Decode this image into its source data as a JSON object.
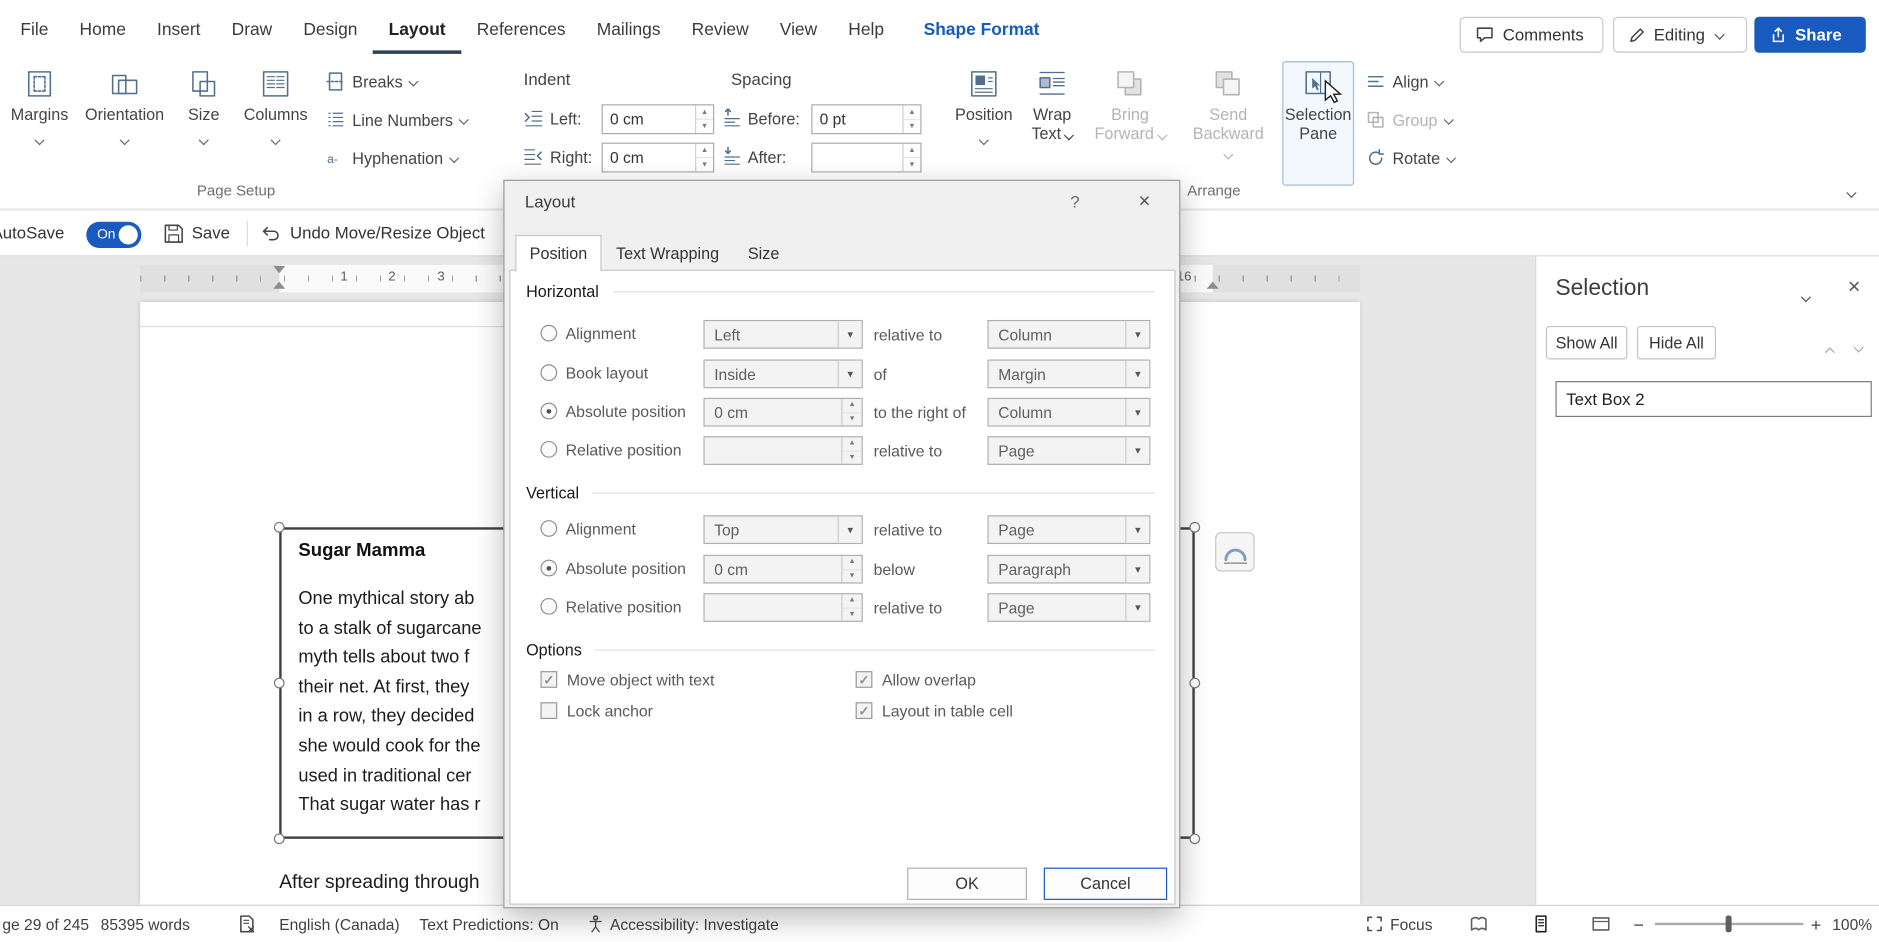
{
  "colors": {
    "accent": "#185abd",
    "underline": "#2d4257",
    "disabled": "#b4b4b4"
  },
  "ribbon": {
    "tabs": [
      "File",
      "Home",
      "Insert",
      "Draw",
      "Design",
      "Layout",
      "References",
      "Mailings",
      "Review",
      "View",
      "Help",
      "Shape Format"
    ],
    "actions": {
      "comments": "Comments",
      "editing": "Editing",
      "share": "Share"
    },
    "page_setup": {
      "group": "Page Setup",
      "margins": "Margins",
      "orientation": "Orientation",
      "size": "Size",
      "columns": "Columns",
      "breaks": "Breaks",
      "line_numbers": "Line Numbers",
      "hyphenation": "Hyphenation"
    },
    "paragraph": {
      "indent": "Indent",
      "spacing": "Spacing",
      "left": "Left:",
      "left_value": "0 cm",
      "right": "Right:",
      "right_value": "0 cm",
      "before": "Before:",
      "before_value": "0 pt",
      "after": "After:",
      "after_value": ""
    },
    "arrange": {
      "group": "Arrange",
      "position": "Position",
      "wrap_text": "Wrap Text",
      "bring_forward": "Bring Forward",
      "send_backward": "Send Backward",
      "selection_pane": "Selection Pane",
      "align": "Align",
      "group_btn": "Group",
      "rotate": "Rotate"
    }
  },
  "qat": {
    "autosave": "AutoSave",
    "autosave_state": "On",
    "save": "Save",
    "undo": "Undo Move/Resize Object"
  },
  "ruler": {
    "n1": "1",
    "n2": "2",
    "n3": "3",
    "n16": "16"
  },
  "document": {
    "textbox_title": "Sugar Mamma",
    "lines": [
      "One mythical story ab",
      "to a stalk of sugarcane",
      "myth tells about two f",
      "their net. At first, they",
      "in a row, they decided",
      "she would cook for the",
      "used in traditional cer",
      "That sugar water has r"
    ],
    "after_text": "After spreading through"
  },
  "dialog": {
    "title": "Layout",
    "help": "?",
    "close": "×",
    "tabs": {
      "position": "Position",
      "wrapping": "Text Wrapping",
      "size": "Size"
    },
    "horizontal": {
      "section": "Horizontal",
      "rows": [
        {
          "label": "Alignment",
          "dot": "",
          "value": "Left",
          "mid": "relative to",
          "value2": "Column"
        },
        {
          "label": "Book layout",
          "dot": "",
          "value": "Inside",
          "mid": "of",
          "value2": "Margin"
        },
        {
          "label": "Absolute position",
          "dot": "●",
          "value": "0 cm",
          "mid": "to the right of",
          "value2": "Column"
        },
        {
          "label": "Relative position",
          "dot": "",
          "value": "",
          "mid": "relative to",
          "value2": "Page"
        }
      ]
    },
    "vertical": {
      "section": "Vertical",
      "rows": [
        {
          "label": "Alignment",
          "dot": "",
          "value": "Top",
          "mid": "relative to",
          "value2": "Page"
        },
        {
          "label": "Absolute position",
          "dot": "●",
          "value": "0 cm",
          "mid": "below",
          "value2": "Paragraph"
        },
        {
          "label": "Relative position",
          "dot": "",
          "value": "",
          "mid": "relative to",
          "value2": "Page"
        }
      ]
    },
    "options": {
      "section": "Options",
      "checks": [
        {
          "label": "Move object with text",
          "mark": "✓"
        },
        {
          "label": "Allow overlap",
          "mark": "✓"
        },
        {
          "label": "Lock anchor",
          "mark": ""
        },
        {
          "label": "Layout in table cell",
          "mark": "✓"
        }
      ]
    },
    "ok": "OK",
    "cancel": "Cancel"
  },
  "selection_pane": {
    "title": "Selection",
    "show_all": "Show All",
    "hide_all": "Hide All",
    "item": "Text Box 2"
  },
  "status": {
    "page": "ge 29 of 245",
    "words": "85395 words",
    "language": "English (Canada)",
    "predictions": "Text Predictions: On",
    "accessibility": "Accessibility: Investigate",
    "focus": "Focus",
    "zoom_out": "−",
    "zoom_in": "+",
    "zoom": "100%"
  }
}
